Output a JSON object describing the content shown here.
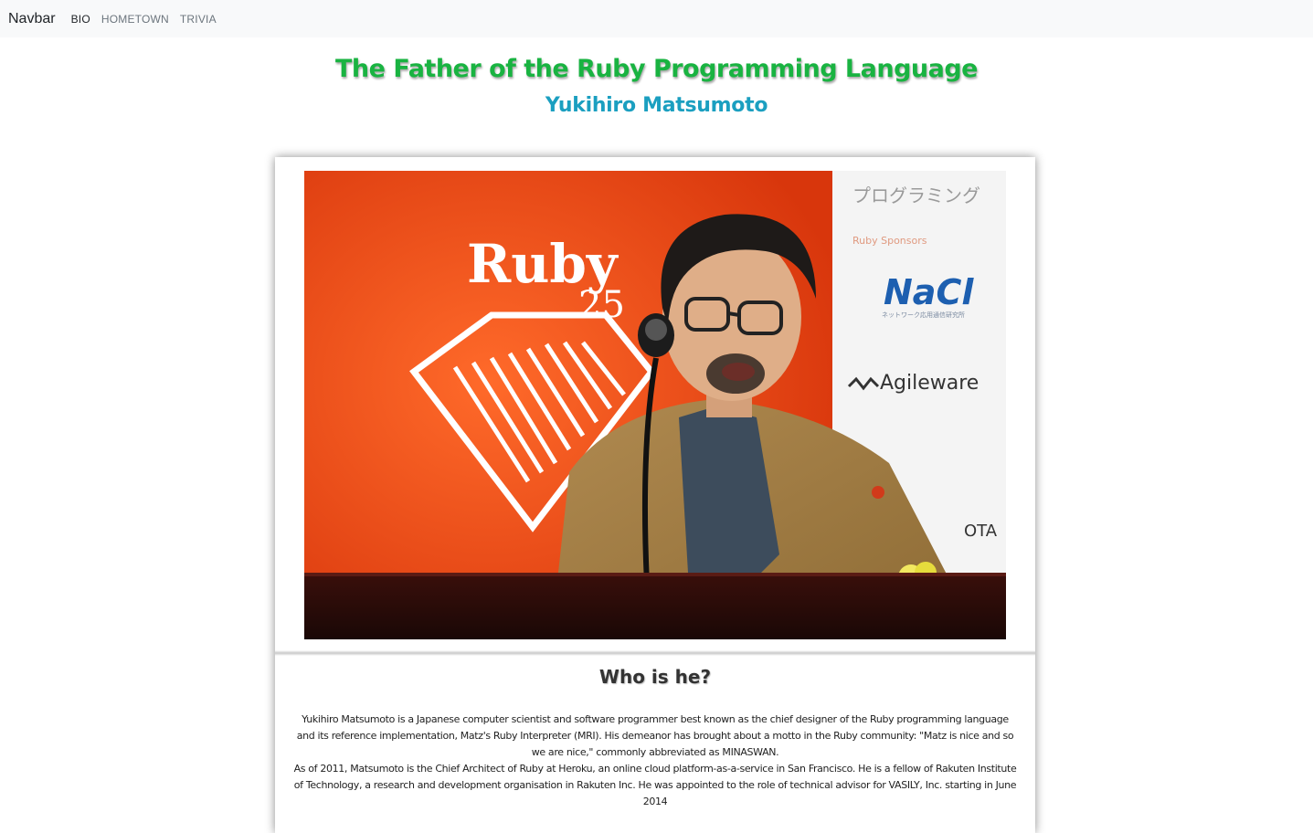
{
  "navbar": {
    "brand": "Navbar",
    "links": [
      {
        "label": "BIO"
      },
      {
        "label": "HOMETOWN"
      },
      {
        "label": "TRIVIA"
      }
    ]
  },
  "header": {
    "title": "The Father of the Ruby Programming Language",
    "subtitle": "Yukihiro Matsumoto"
  },
  "photo": {
    "banner_logo": "Ruby",
    "banner_number": "25",
    "sponsor_jp": "プログラミング",
    "sponsor_label": "Ruby Sponsors",
    "sponsor_nacl": "NaCl",
    "sponsor_nacl_sub": "ネットワーク応用通信研究所",
    "sponsor_agileware": "Agileware",
    "sponsor_partial": "OTA"
  },
  "card": {
    "heading": "Who is he?",
    "paragraph_1": "Yukihiro Matsumoto is a Japanese computer scientist and software programmer best known as the chief designer of the Ruby programming language and its reference implementation, Matz's Ruby Interpreter (MRI). His demeanor has brought about a motto in the Ruby community: \"Matz is nice and so we are nice,\" commonly abbreviated as MINASWAN.",
    "paragraph_2": "As of 2011, Matsumoto is the Chief Architect of Ruby at Heroku, an online cloud platform-as-a-service in San Francisco. He is a fellow of Rakuten Institute of Technology, a research and development organisation in Rakuten Inc. He was appointed to the role of technical advisor for VASILY, Inc. starting in June 2014"
  },
  "colors": {
    "title": "#19b341",
    "subtitle": "#1b9fc0",
    "navbar_bg": "#f8f9fa",
    "banner_orange": "#e84a12"
  }
}
